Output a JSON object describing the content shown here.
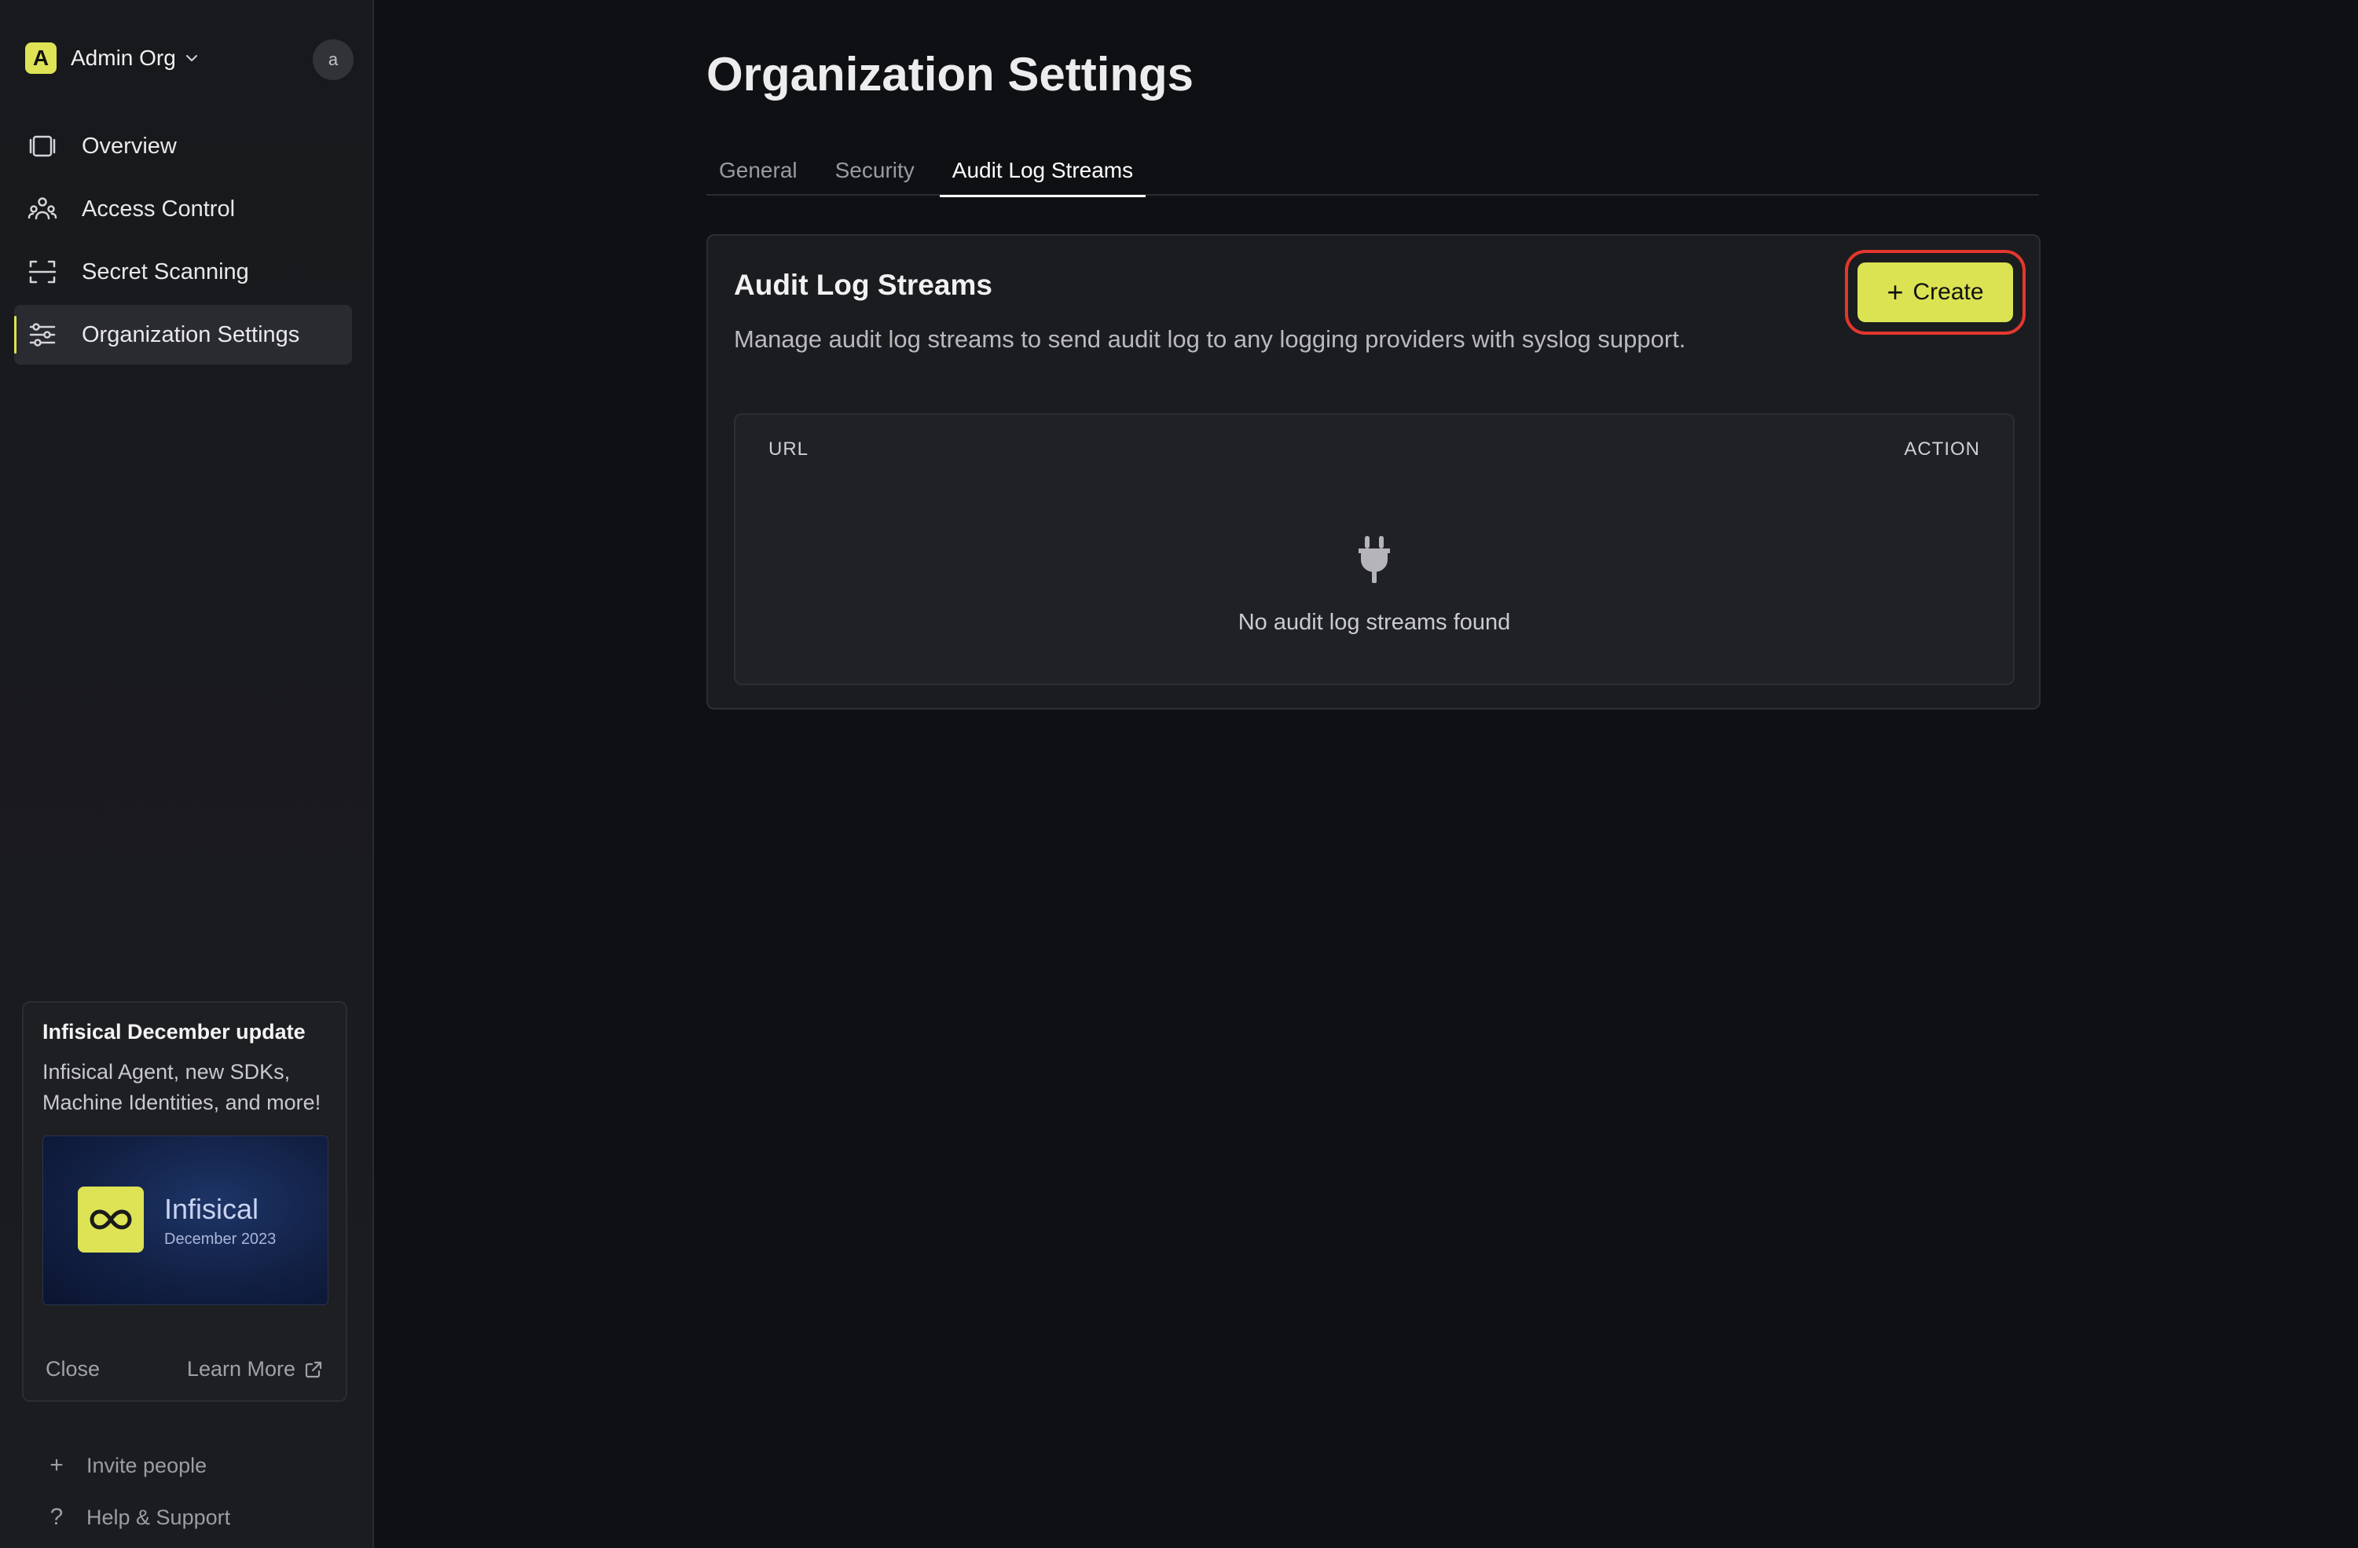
{
  "sidebar": {
    "org": {
      "initial": "A",
      "name": "Admin Org"
    },
    "user_initial": "a",
    "items": [
      {
        "label": "Overview",
        "icon": "overview-icon"
      },
      {
        "label": "Access Control",
        "icon": "users-icon"
      },
      {
        "label": "Secret Scanning",
        "icon": "scan-icon"
      },
      {
        "label": "Organization Settings",
        "icon": "sliders-icon",
        "active": true
      }
    ],
    "update_card": {
      "title": "Infisical December update",
      "description": "Infisical Agent, new SDKs, Machine Identities, and more!",
      "banner_name": "Infisical",
      "banner_date": "December 2023",
      "close_label": "Close",
      "learn_more_label": "Learn More"
    },
    "footer": {
      "invite": "Invite people",
      "help": "Help & Support"
    }
  },
  "main": {
    "title": "Organization Settings",
    "tabs": [
      {
        "label": "General"
      },
      {
        "label": "Security"
      },
      {
        "label": "Audit Log Streams",
        "active": true
      }
    ],
    "card": {
      "title": "Audit Log Streams",
      "description": "Manage audit log streams to send audit log to any logging providers with syslog support.",
      "create_label": "Create",
      "table": {
        "columns": [
          "URL",
          "ACTION"
        ],
        "empty_text": "No audit log streams found"
      }
    }
  },
  "colors": {
    "accent": "#dbe352",
    "highlight_border": "#e4372d",
    "background": "#0f1014"
  }
}
